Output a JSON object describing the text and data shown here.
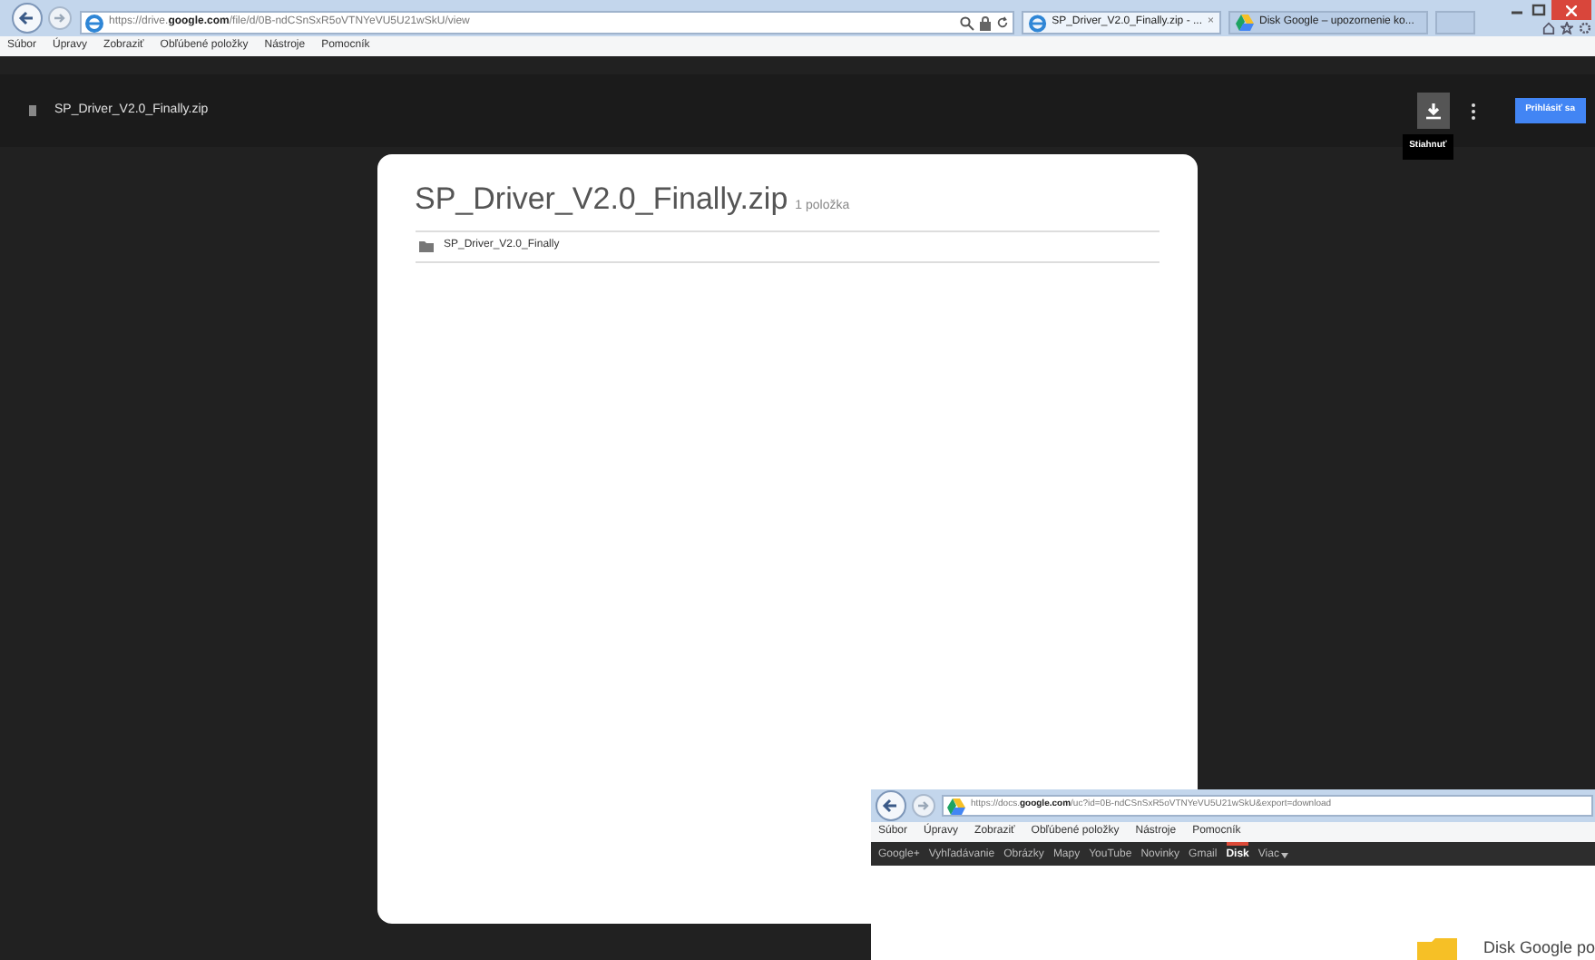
{
  "browser": {
    "url": "https://drive.**google.com**/file/d/0B-ndCSnSxR5oVTNYeVU5U21wSkU/view",
    "tabs": [
      {
        "title": "SP_Driver_V2.0_Finally.zip - ...",
        "close": "×",
        "selected": true,
        "kind": "file"
      },
      {
        "title": "Disk Google – upozornenie ko...",
        "selected": false,
        "kind": "drive"
      }
    ],
    "menu": [
      "Súbor",
      "Úpravy",
      "Zobraziť",
      "Obľúbené položky",
      "Nástroje",
      "Pomocník"
    ]
  },
  "viewer": {
    "file_name": "SP_Driver_V2.0_Finally.zip",
    "download_tooltip": "Stiahnuť",
    "sign_in": "Prihlásiť sa"
  },
  "archive": {
    "title": "SP_Driver_V2.0_Finally.zip",
    "count": "1 položka",
    "entries": [
      {
        "name": "SP_Driver_V2.0_Finally",
        "kind": "folder"
      }
    ]
  },
  "second_window": {
    "url": "https://docs.**google.com**/uc?id=0B-ndCSnSxR5oVTNYeVU5U21wSkU&export=download",
    "menu": [
      "Súbor",
      "Úpravy",
      "Zobraziť",
      "Obľúbené položky",
      "Nástroje",
      "Pomocník"
    ],
    "google_bar": [
      {
        "label": "Google+",
        "selected": false
      },
      {
        "label": "Vyhľadávanie",
        "selected": false
      },
      {
        "label": "Obrázky",
        "selected": false
      },
      {
        "label": "Mapy",
        "selected": false
      },
      {
        "label": "YouTube",
        "selected": false
      },
      {
        "label": "Novinky",
        "selected": false
      },
      {
        "label": "Gmail",
        "selected": false
      },
      {
        "label": "Disk",
        "selected": true
      },
      {
        "label": "Viac",
        "selected": false
      }
    ],
    "page_text": "Disk Google po"
  }
}
